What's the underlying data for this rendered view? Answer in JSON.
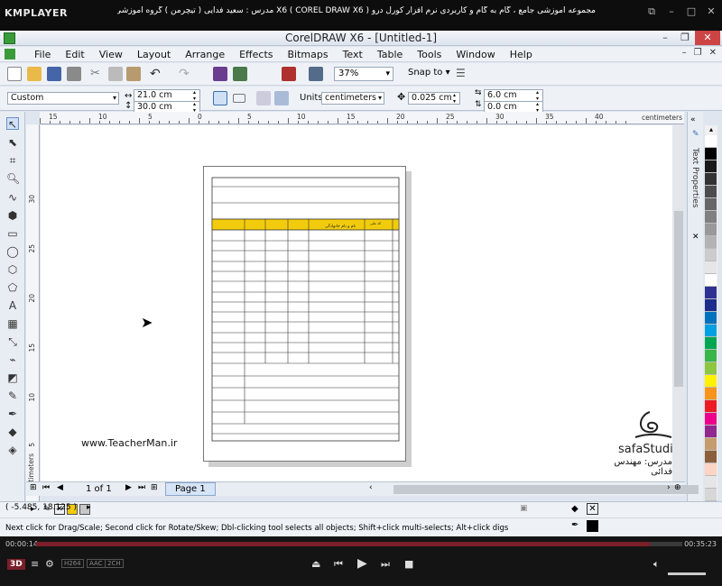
{
  "player": {
    "name": "KMPLAYER",
    "title": "مجموعه آموزشی جامع ، گام به گام و کاربردی نرم افزار کورل درو X6 ( COREL DRAW X6 )  مدرس : سعید فدایی ( تیچرمن ) گروه آموزشی پادشاه گرافیست ها",
    "elapsed": "00:00:14",
    "duration": "00:35:23",
    "progress_fraction": 0.95,
    "badges": [
      "H264",
      "AAC",
      "2CH"
    ]
  },
  "app": {
    "title": "CorelDRAW X6 - [Untitled-1]"
  },
  "menu": {
    "items": [
      "File",
      "Edit",
      "View",
      "Layout",
      "Arrange",
      "Effects",
      "Bitmaps",
      "Text",
      "Table",
      "Tools",
      "Window",
      "Help"
    ]
  },
  "toolbar": {
    "zoom": "37%",
    "snap_to": "Snap to"
  },
  "property_bar": {
    "page_size": "Custom",
    "width": "21.0 cm",
    "height": "30.0 cm",
    "units_label": "Units:",
    "units": "centimeters",
    "nudge": "0.025 cm",
    "dup_x": "6.0 cm",
    "dup_y": "0.0 cm"
  },
  "rulers": {
    "h_labels": [
      "15",
      "10",
      "5",
      "0",
      "5",
      "10",
      "15",
      "20",
      "25",
      "30",
      "35",
      "40"
    ],
    "h_unit": "centimeters",
    "v_labels": [
      "30",
      "25",
      "20",
      "15",
      "10",
      "5"
    ],
    "v_unit": "centimeters"
  },
  "canvas": {
    "watermark_left": "www.TeacherMan.ir",
    "studio": "safaStudio.ir",
    "teacher": "مدرس: مهندس فدائی",
    "table_header_cells": [
      "نام و نام خانوادگی",
      "کد ملی"
    ]
  },
  "docker": {
    "label": "Text Properties"
  },
  "pages": {
    "counter": "1 of 1",
    "tab": "Page 1"
  },
  "status": {
    "coords": "( -5.485, 18.125 )",
    "hint": "Next click for Drag/Scale; Second click for Rotate/Skew; Dbl-clicking tool selects all objects; Shift+click multi-selects; Alt+click digs"
  },
  "colors": {
    "table_header": "#f2cc0c",
    "palette": [
      "#ffffff",
      "#000000",
      "#1a1a1a",
      "#333333",
      "#4d4d4d",
      "#666666",
      "#808080",
      "#999999",
      "#b3b3b3",
      "#cccccc",
      "#e6e6e6",
      "#ffffff",
      "#2e3192",
      "#1e2c8c",
      "#0071bc",
      "#00a0e3",
      "#00a651",
      "#39b54a",
      "#8dc63f",
      "#fff200",
      "#f7941d",
      "#ed1c24",
      "#ec008c",
      "#92278f",
      "#c69c6d",
      "#8b5e3c",
      "#fbd4c4",
      "#e6e6e6",
      "#d7d7d7",
      "#c8c8c8"
    ]
  }
}
